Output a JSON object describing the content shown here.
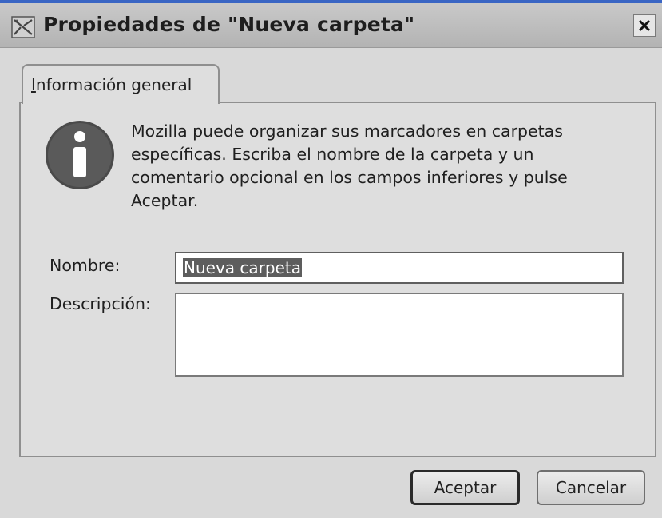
{
  "window": {
    "title": "Propiedades de \"Nueva carpeta\""
  },
  "tabs": [
    {
      "label": "Información general",
      "selected": true
    }
  ],
  "info": {
    "icon": "info-icon",
    "text": "Mozilla puede organizar sus marcadores en carpetas específicas. Escriba el nombre de la carpeta y un comentario opcional en los campos inferiores y pulse Aceptar."
  },
  "form": {
    "name_label": "Nombre:",
    "name_value": "Nueva carpeta",
    "description_label": "Descripción:",
    "description_value": ""
  },
  "buttons": {
    "ok": "Aceptar",
    "cancel": "Cancelar"
  }
}
